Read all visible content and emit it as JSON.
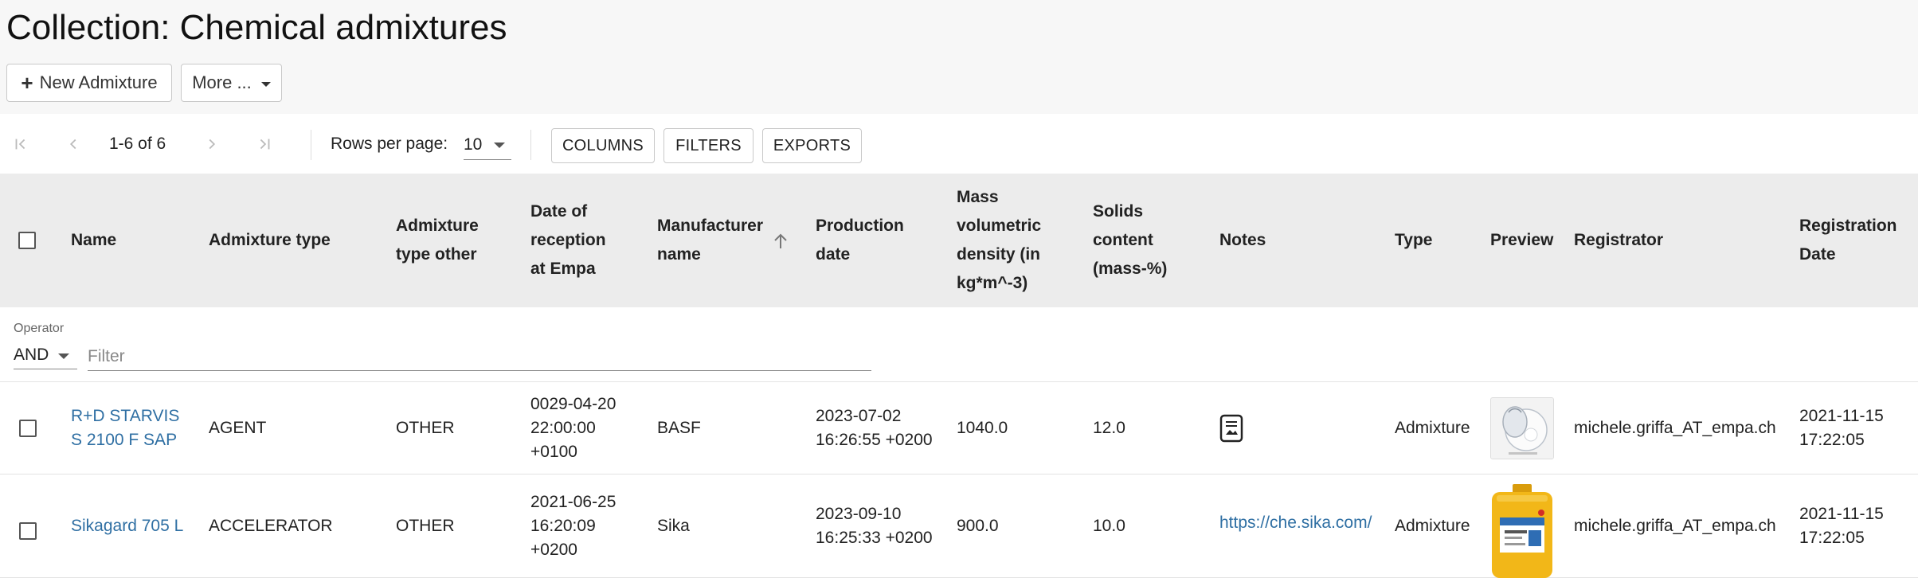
{
  "page": {
    "title": "Collection: Chemical admixtures",
    "new_button": "New Admixture",
    "more_button": "More ..."
  },
  "toolbar": {
    "range": "1-6 of 6",
    "rows_per_page_label": "Rows per page:",
    "rows_per_page_value": "10",
    "columns_button": "COLUMNS",
    "filters_button": "FILTERS",
    "exports_button": "EXPORTS"
  },
  "table": {
    "headers": {
      "name": "Name",
      "admixture_type": "Admixture type",
      "admixture_type_other": [
        "Admixture",
        "type other"
      ],
      "date_of_reception": [
        "Date of",
        "reception",
        "at Empa"
      ],
      "manufacturer_name": [
        "Manufacturer",
        "name"
      ],
      "production_date": [
        "Production",
        "date"
      ],
      "mass_density": [
        "Mass",
        "volumetric",
        "density (in",
        "kg*m^-3)"
      ],
      "solids_content": [
        "Solids",
        "content",
        "(mass-%)"
      ],
      "notes": "Notes",
      "type": "Type",
      "preview": "Preview",
      "registrator": "Registrator",
      "registration_date": [
        "Registration",
        "Date"
      ]
    },
    "sort_column": "manufacturer_name",
    "sort_direction": "ascending",
    "filter": {
      "operator_label": "Operator",
      "operator_value": "AND",
      "placeholder": "Filter"
    },
    "rows": [
      {
        "name": [
          "R+D STARVIS",
          "S 2100 F SAP"
        ],
        "admixture_type": "AGENT",
        "admixture_type_other": "OTHER",
        "date_of_reception": [
          "0029-04-20",
          "22:00:00",
          "+0100"
        ],
        "manufacturer_name": "BASF",
        "production_date": [
          "2023-07-02",
          "16:26:55 +0200"
        ],
        "mass_density": "1040.0",
        "solids_content": "12.0",
        "notes_icon": "document-icon",
        "type": "Admixture",
        "preview": "white-powder-bag",
        "registrator": "michele.griffa_AT_empa.ch",
        "registration_date": [
          "2021-11-15",
          "17:22:05"
        ]
      },
      {
        "name": [
          "Sikagard 705 L"
        ],
        "admixture_type": "ACCELERATOR",
        "admixture_type_other": "OTHER",
        "date_of_reception": [
          "2021-06-25",
          "16:20:09",
          "+0200"
        ],
        "manufacturer_name": "Sika",
        "production_date": [
          "2023-09-10",
          "16:25:33 +0200"
        ],
        "mass_density": "900.0",
        "solids_content": "10.0",
        "notes_link": "https://che.sika.com/",
        "type": "Admixture",
        "preview": "yellow-canister",
        "registrator": "michele.griffa_AT_empa.ch",
        "registration_date": [
          "2021-11-15",
          "17:22:05"
        ]
      }
    ]
  },
  "colors": {
    "link": "#2f6fa3",
    "header_bg": "#ececec",
    "top_bg": "#f7f7f7",
    "canister_yellow": "#f2b718"
  }
}
